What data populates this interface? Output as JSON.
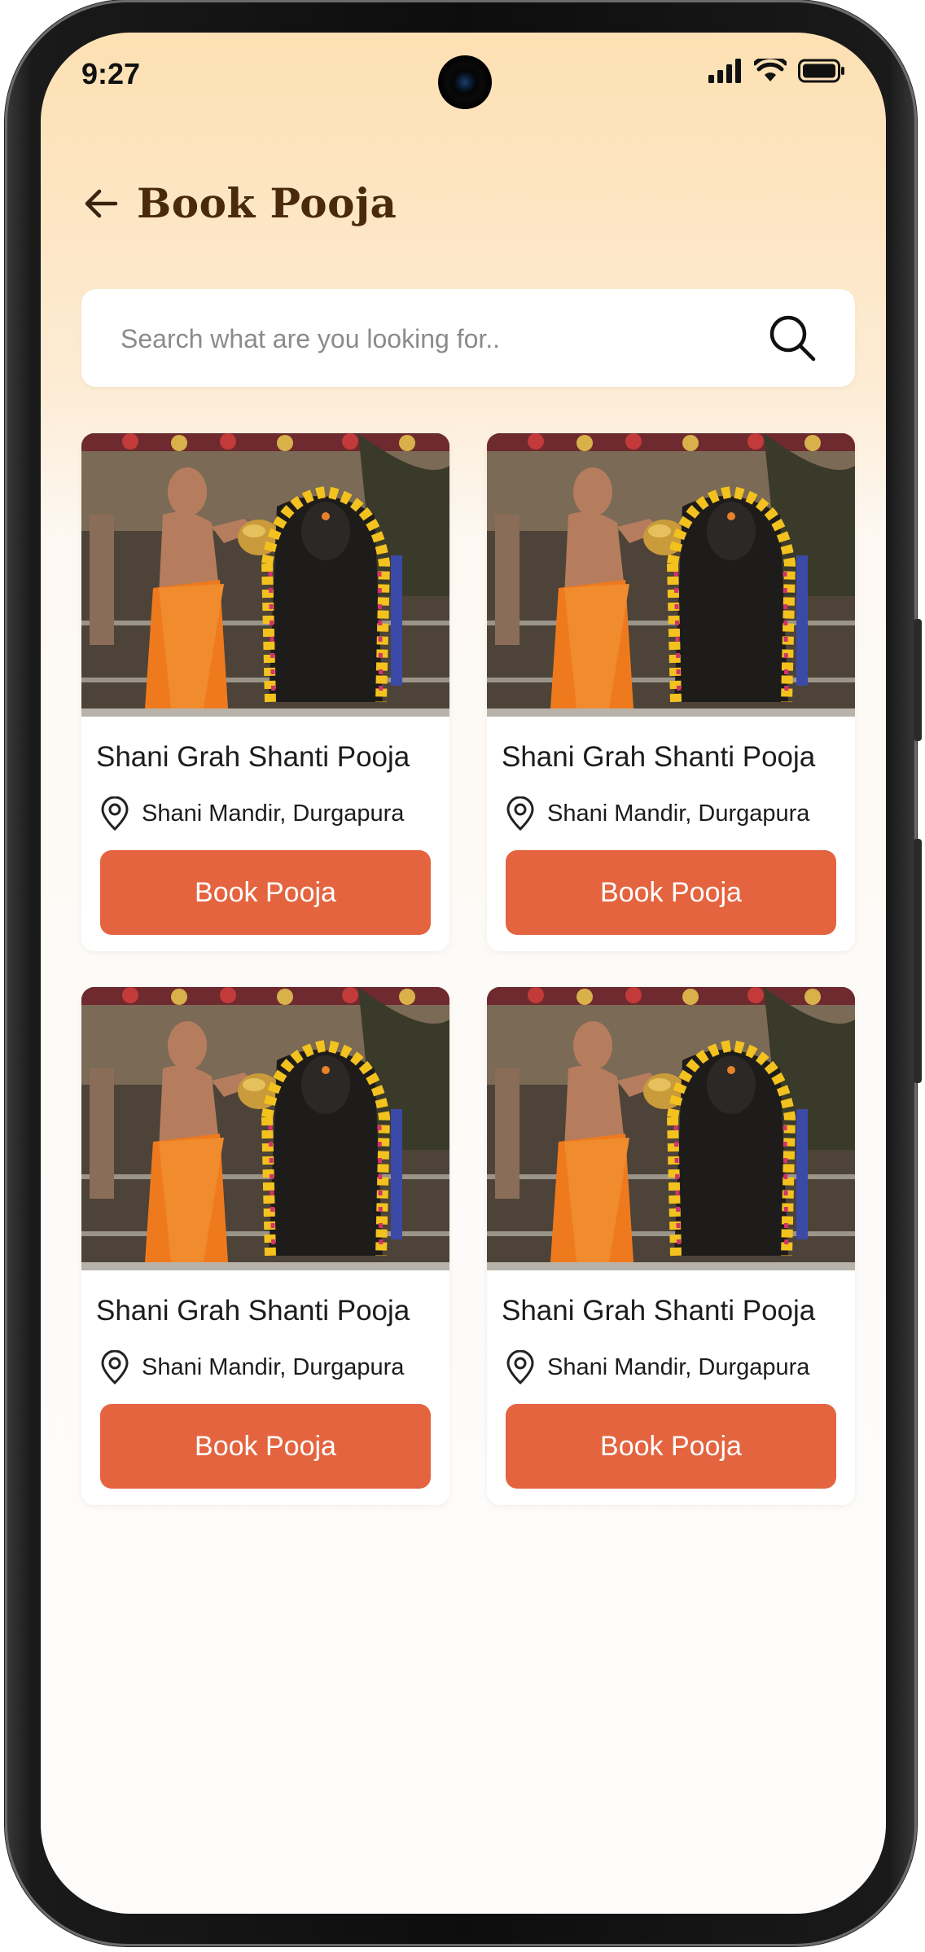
{
  "status_bar": {
    "time": "9:27"
  },
  "header": {
    "back_icon": "arrow-left-icon",
    "title": "Book Pooja"
  },
  "search": {
    "placeholder": "Search what are you looking for..",
    "value": "",
    "icon": "search-icon"
  },
  "cards": [
    {
      "image": "priest-pouring-water-on-idol-photo",
      "title": "Shani Grah Shanti Pooja",
      "location_icon": "location-pin-icon",
      "location": "Shani Mandir, Durgapura",
      "button_label": "Book Pooja"
    },
    {
      "image": "priest-pouring-water-on-idol-photo",
      "title": "Shani Grah Shanti Pooja",
      "location_icon": "location-pin-icon",
      "location": "Shani Mandir, Durgapura",
      "button_label": "Book Pooja"
    },
    {
      "image": "priest-pouring-water-on-idol-photo",
      "title": "Shani Grah Shanti Pooja",
      "location_icon": "location-pin-icon",
      "location": "Shani Mandir, Durgapura",
      "button_label": "Book Pooja"
    },
    {
      "image": "priest-pouring-water-on-idol-photo",
      "title": "Shani Grah Shanti Pooja",
      "location_icon": "location-pin-icon",
      "location": "Shani Mandir, Durgapura",
      "button_label": "Book Pooja"
    }
  ],
  "colors": {
    "accent_button": "#e4643f",
    "title_brown": "#4a2a0c",
    "header_gradient_top": "#fde0b3"
  }
}
